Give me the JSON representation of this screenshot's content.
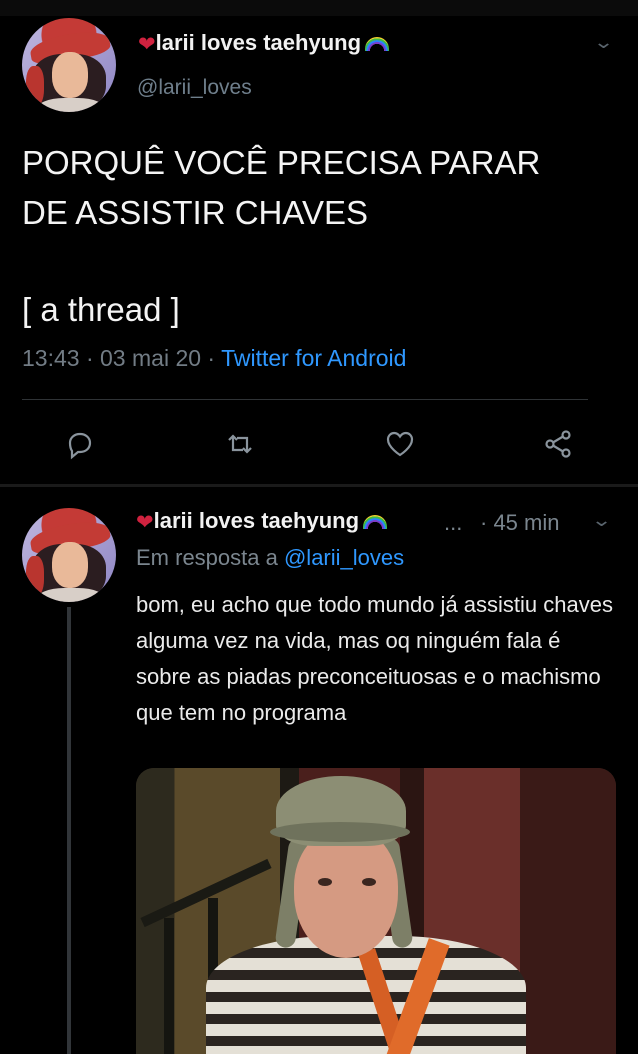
{
  "main_tweet": {
    "display_name": "larii loves taehyung",
    "handle": "@larii_loves",
    "text_line1": "PORQUÊ VOCÊ PRECISA PARAR",
    "text_line2": "DE ASSISTIR CHAVES",
    "text_line3": "[ a thread ]",
    "time": "13:43",
    "date": "03 mai 20",
    "source": "Twitter for Android",
    "separator": "·"
  },
  "reply_tweet": {
    "display_name": "larii loves taehyung",
    "ellipsis": "...",
    "time_ago": "· 45 min",
    "in_reply_prefix": "Em resposta a",
    "in_reply_handle": "@larii_loves",
    "text": "bom, eu acho que todo mundo já assistiu chaves alguma vez na vida, mas oq ninguém fala é sobre as piadas preconceituosas e o machismo que tem no programa"
  },
  "icons": {
    "heart": "heart-icon",
    "rainbow": "rainbow-icon",
    "reply": "reply-icon",
    "retweet": "retweet-icon",
    "like": "like-icon",
    "share": "share-icon",
    "chevron": "chevron-down-icon"
  },
  "colors": {
    "background": "#000000",
    "link": "#2f98ff",
    "muted": "#727c85",
    "text": "#f4f4f4"
  }
}
